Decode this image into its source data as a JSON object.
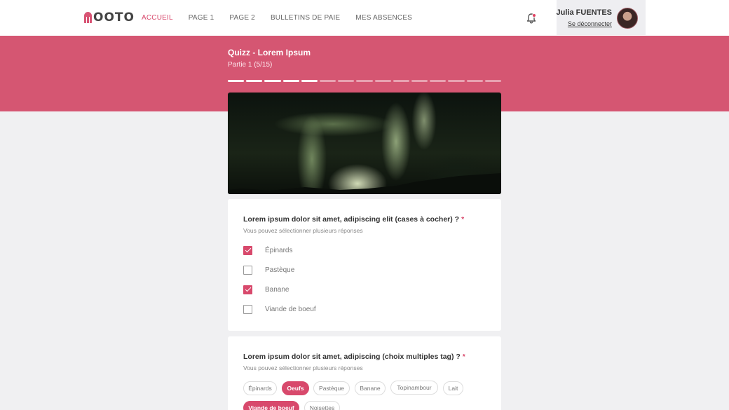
{
  "header": {
    "logo_text": "OOTO",
    "nav": [
      {
        "label": "ACCUEIL",
        "active": true
      },
      {
        "label": "PAGE 1",
        "active": false
      },
      {
        "label": "PAGE 2",
        "active": false
      },
      {
        "label": "BULLETINS DE PAIE",
        "active": false
      },
      {
        "label": "MES ABSENCES",
        "active": false
      }
    ],
    "notification_icon": "bell-icon",
    "user": {
      "name": "Julia FUENTES",
      "logout_label": "Se déconnecter"
    }
  },
  "quiz": {
    "title": "Quizz - Lorem Ipsum",
    "subtitle": "Partie 1 (5/15)",
    "progress": {
      "completed": 5,
      "total": 15
    }
  },
  "question1": {
    "title": "Lorem ipsum dolor sit amet, adipiscing elit (cases à cocher) ?",
    "required_mark": "*",
    "hint": "Vous pouvez sélectionner plusieurs réponses",
    "options": [
      {
        "label": "Épinards",
        "checked": true
      },
      {
        "label": "Pastèque",
        "checked": false
      },
      {
        "label": "Banane",
        "checked": true
      },
      {
        "label": "Viande de boeuf",
        "checked": false
      }
    ]
  },
  "question2": {
    "title": "Lorem ipsum dolor sit amet, adipiscing (choix multiples tag) ?",
    "required_mark": "*",
    "hint": "Vous pouvez sélectionner plusieurs réponses",
    "tags": [
      {
        "label": "Épinards",
        "selected": false
      },
      {
        "label": "Oeufs",
        "selected": true
      },
      {
        "label": "Pastèque",
        "selected": false
      },
      {
        "label": "Banane",
        "selected": false
      },
      {
        "label": "Topinambour",
        "selected": false
      },
      {
        "label": "Lait",
        "selected": false
      },
      {
        "label": "Viande de boeuf",
        "selected": true
      },
      {
        "label": "Noisettes",
        "selected": false
      }
    ]
  },
  "colors": {
    "accent": "#d8496c",
    "band": "#d55672"
  }
}
